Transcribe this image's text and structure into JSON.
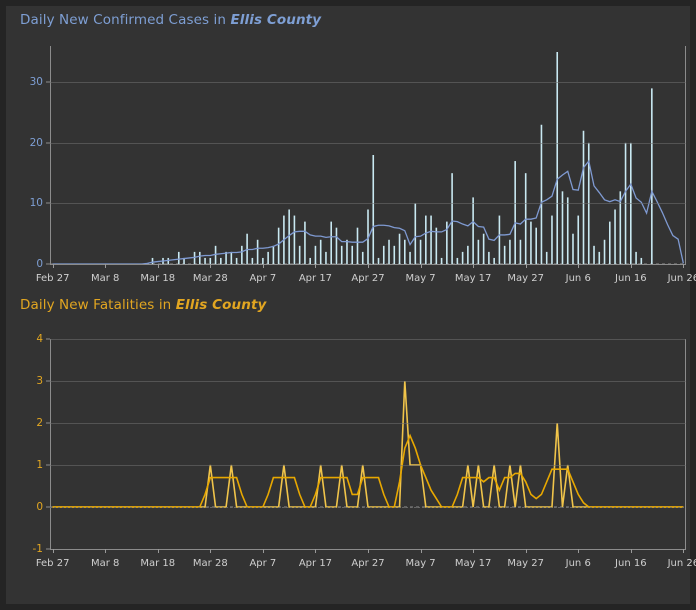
{
  "page": {
    "background": "#333333",
    "frame_color": "#242424"
  },
  "panels": [
    {
      "id": "cases",
      "title_main": "Daily New Confirmed Cases in ",
      "title_county": "Ellis County",
      "title_color": "#7e9fd4"
    },
    {
      "id": "fatalities",
      "title_main": "Daily New Fatalities in ",
      "title_county": "Ellis County",
      "title_color": "#e2a621"
    }
  ],
  "chart_data": [
    {
      "type": "bar",
      "id": "daily-new-confirmed-cases",
      "title": "Daily New Confirmed Cases in Ellis County",
      "xlabel": "",
      "ylabel": "",
      "ylim": [
        0,
        36
      ],
      "yticks": [
        0,
        10,
        20,
        30
      ],
      "grid": true,
      "legend": "none",
      "bar_color": "#c9e9f2",
      "line_color": "#7f9ad2",
      "x_start": "Feb 27",
      "x_end": "Jun 26",
      "xtick_labels": [
        "Feb 27",
        "Mar 8",
        "Mar 18",
        "Mar 28",
        "Apr 7",
        "Apr 17",
        "Apr 27",
        "May 7",
        "May 17",
        "May 27",
        "Jun 6",
        "Jun 16",
        "Jun 26"
      ],
      "xtick_indices": [
        0,
        10,
        20,
        30,
        40,
        50,
        60,
        70,
        80,
        90,
        100,
        110,
        120
      ],
      "series": [
        {
          "name": "Daily new confirmed cases",
          "type": "bar",
          "values": [
            0,
            0,
            0,
            0,
            0,
            0,
            0,
            0,
            0,
            0,
            0,
            0,
            0,
            0,
            0,
            0,
            0,
            0,
            0,
            1,
            0,
            1,
            1,
            0,
            2,
            1,
            0,
            2,
            2,
            1,
            1,
            3,
            1,
            2,
            2,
            1,
            3,
            5,
            1,
            4,
            1,
            2,
            3,
            6,
            8,
            9,
            8,
            3,
            7,
            1,
            3,
            4,
            2,
            7,
            6,
            3,
            4,
            3,
            6,
            2,
            9,
            18,
            1,
            3,
            4,
            3,
            5,
            4,
            2,
            10,
            4,
            8,
            8,
            6,
            1,
            7,
            15,
            1,
            2,
            3,
            11,
            4,
            5,
            2,
            1,
            8,
            3,
            4,
            17,
            4,
            15,
            7,
            6,
            23,
            2,
            8,
            35,
            12,
            11,
            5,
            8,
            22,
            20,
            3,
            2,
            4,
            7,
            9,
            12,
            20,
            20,
            2,
            1,
            0,
            29,
            0,
            0,
            0,
            0,
            0,
            0
          ]
        },
        {
          "name": "7-day moving average",
          "type": "line",
          "values": [
            0,
            0,
            0,
            0,
            0,
            0,
            0,
            0,
            0,
            0,
            0,
            0,
            0,
            0,
            0,
            0,
            0,
            0,
            0.1,
            0.3,
            0.4,
            0.5,
            0.6,
            0.7,
            0.8,
            0.9,
            1.0,
            1.1,
            1.3,
            1.4,
            1.4,
            1.6,
            1.7,
            1.8,
            1.9,
            1.9,
            2.0,
            2.4,
            2.4,
            2.6,
            2.6,
            2.7,
            2.9,
            3.3,
            4.0,
            4.7,
            5.3,
            5.4,
            5.4,
            4.8,
            4.6,
            4.6,
            4.4,
            4.5,
            4.5,
            3.7,
            3.7,
            3.6,
            3.6,
            3.6,
            4.2,
            6.2,
            6.4,
            6.4,
            6.3,
            6.0,
            5.9,
            5.5,
            3.2,
            4.5,
            4.6,
            5.1,
            5.4,
            5.3,
            5.3,
            5.7,
            7.1,
            7.0,
            6.6,
            6.3,
            7.0,
            6.2,
            6.1,
            4.1,
            3.9,
            4.8,
            4.8,
            4.9,
            6.8,
            6.6,
            7.4,
            7.4,
            7.6,
            10.2,
            10.6,
            11.2,
            14.0,
            14.7,
            15.3,
            12.3,
            12.2,
            15.9,
            17.0,
            12.9,
            11.8,
            10.6,
            10.3,
            10.6,
            10.3,
            12.0,
            13.2,
            10.9,
            10.2,
            8.4,
            12.0,
            10.3,
            8.5,
            6.5,
            4.7,
            4.1,
            0.1
          ]
        }
      ]
    },
    {
      "type": "line",
      "id": "daily-new-fatalities",
      "title": "Daily New Fatalities in Ellis County",
      "xlabel": "",
      "ylabel": "",
      "ylim": [
        -1,
        4
      ],
      "yticks": [
        -1,
        0,
        1,
        2,
        3,
        4
      ],
      "grid": true,
      "legend": "none",
      "line_color": "#f0c44a",
      "ma_color": "#e8a800",
      "x_start": "Feb 27",
      "x_end": "Jun 26",
      "xtick_labels": [
        "Feb 27",
        "Mar 8",
        "Mar 18",
        "Mar 28",
        "Apr 7",
        "Apr 17",
        "Apr 27",
        "May 7",
        "May 17",
        "May 27",
        "Jun 6",
        "Jun 16",
        "Jun 26"
      ],
      "xtick_indices": [
        0,
        10,
        20,
        30,
        40,
        50,
        60,
        70,
        80,
        90,
        100,
        110,
        120
      ],
      "series": [
        {
          "name": "Daily new fatalities",
          "type": "line",
          "values": [
            0,
            0,
            0,
            0,
            0,
            0,
            0,
            0,
            0,
            0,
            0,
            0,
            0,
            0,
            0,
            0,
            0,
            0,
            0,
            0,
            0,
            0,
            0,
            0,
            0,
            0,
            0,
            0,
            0,
            0,
            1,
            0,
            0,
            0,
            1,
            0,
            0,
            0,
            0,
            0,
            0,
            0,
            0,
            0,
            1,
            0,
            0,
            0,
            0,
            0,
            0,
            1,
            0,
            0,
            0,
            1,
            0,
            0,
            0,
            1,
            0,
            0,
            0,
            0,
            0,
            0,
            0,
            3,
            1,
            1,
            1,
            0,
            0,
            0,
            0,
            0,
            0,
            0,
            0,
            1,
            0,
            1,
            0,
            0,
            1,
            0,
            0,
            1,
            0,
            1,
            0,
            0,
            0,
            0,
            0,
            0,
            2,
            0,
            1,
            0,
            0,
            0,
            0,
            0,
            0,
            0,
            0,
            0,
            0,
            0,
            0,
            0,
            0,
            0,
            0,
            0,
            0,
            0,
            0,
            0,
            0
          ]
        },
        {
          "name": "7-day moving average",
          "type": "line",
          "values": [
            0,
            0,
            0,
            0,
            0,
            0,
            0,
            0,
            0,
            0,
            0,
            0,
            0,
            0,
            0,
            0,
            0,
            0,
            0,
            0,
            0,
            0,
            0,
            0,
            0,
            0,
            0,
            0,
            0,
            0.3,
            0.7,
            0.7,
            0.7,
            0.7,
            0.7,
            0.7,
            0.3,
            0,
            0,
            0,
            0,
            0.3,
            0.7,
            0.7,
            0.7,
            0.7,
            0.7,
            0.3,
            0,
            0,
            0.3,
            0.7,
            0.7,
            0.7,
            0.7,
            0.7,
            0.7,
            0.3,
            0.3,
            0.7,
            0.7,
            0.7,
            0.7,
            0.3,
            0,
            0,
            0.6,
            1.4,
            1.7,
            1.4,
            1.0,
            0.7,
            0.4,
            0.2,
            0,
            0,
            0,
            0.3,
            0.7,
            0.7,
            0.7,
            0.7,
            0.6,
            0.7,
            0.7,
            0.4,
            0.7,
            0.7,
            0.8,
            0.8,
            0.6,
            0.3,
            0.2,
            0.3,
            0.6,
            0.9,
            0.9,
            0.9,
            0.9,
            0.6,
            0.3,
            0.1,
            0,
            0,
            0,
            0,
            0,
            0,
            0,
            0,
            0,
            0,
            0,
            0,
            0,
            0,
            0,
            0,
            0,
            0,
            0
          ]
        }
      ]
    }
  ]
}
